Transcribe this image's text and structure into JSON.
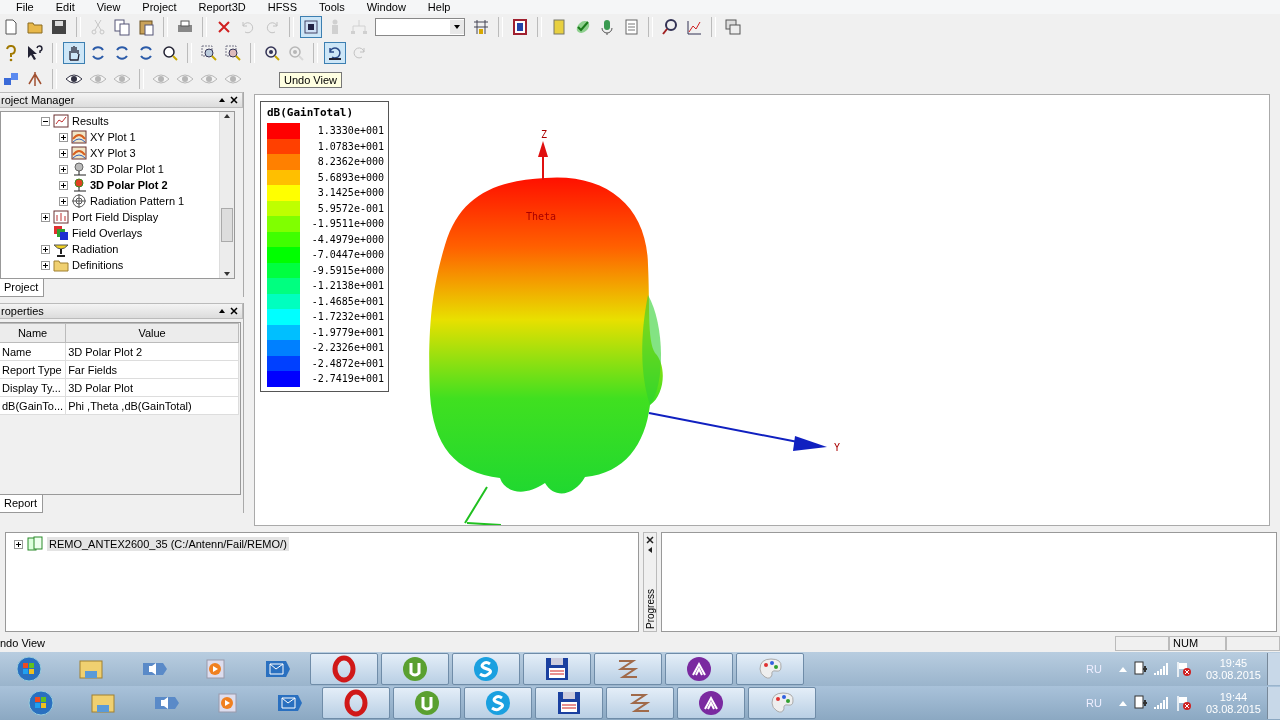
{
  "menu": [
    "File",
    "Edit",
    "View",
    "Project",
    "Report3D",
    "HFSS",
    "Tools",
    "Window",
    "Help"
  ],
  "toolbars": [
    {
      "buttons": [
        {
          "kind": "new",
          "pressed": false,
          "disabled": false
        },
        {
          "kind": "open",
          "pressed": false,
          "disabled": false
        },
        {
          "kind": "save",
          "pressed": false,
          "disabled": false
        },
        {
          "kind": "sep"
        },
        {
          "kind": "cut",
          "pressed": false,
          "disabled": true
        },
        {
          "kind": "copy",
          "pressed": false,
          "disabled": false
        },
        {
          "kind": "paste",
          "pressed": false,
          "disabled": false
        },
        {
          "kind": "sep"
        },
        {
          "kind": "print",
          "pressed": false,
          "disabled": false
        },
        {
          "kind": "sep"
        },
        {
          "kind": "delete",
          "pressed": false,
          "disabled": false
        },
        {
          "kind": "undo",
          "pressed": false,
          "disabled": true
        },
        {
          "kind": "redo",
          "pressed": false,
          "disabled": true
        },
        {
          "kind": "sep"
        },
        {
          "kind": "select",
          "pressed": true,
          "disabled": false
        },
        {
          "kind": "figure",
          "pressed": false,
          "disabled": true
        },
        {
          "kind": "network",
          "pressed": false,
          "disabled": true
        },
        {
          "kind": "combo"
        },
        {
          "kind": "grid",
          "pressed": false,
          "disabled": false
        },
        {
          "kind": "sep"
        },
        {
          "kind": "mark",
          "pressed": false,
          "disabled": false
        },
        {
          "kind": "sep"
        },
        {
          "kind": "validate",
          "pressed": false,
          "disabled": false
        },
        {
          "kind": "check",
          "pressed": false,
          "disabled": false
        },
        {
          "kind": "analyze",
          "pressed": false,
          "disabled": false
        },
        {
          "kind": "report",
          "pressed": false,
          "disabled": false
        },
        {
          "kind": "sep"
        },
        {
          "kind": "find",
          "pressed": false,
          "disabled": false
        },
        {
          "kind": "plot",
          "pressed": false,
          "disabled": false
        },
        {
          "kind": "sep"
        },
        {
          "kind": "window",
          "pressed": false,
          "disabled": false
        }
      ]
    },
    {
      "buttons": [
        {
          "kind": "help",
          "pressed": false,
          "disabled": false
        },
        {
          "kind": "whatsthis",
          "pressed": false,
          "disabled": false
        },
        {
          "kind": "sep"
        },
        {
          "kind": "pan",
          "pressed": true,
          "disabled": false
        },
        {
          "kind": "rotate",
          "pressed": false,
          "disabled": false
        },
        {
          "kind": "rotate",
          "pressed": false,
          "disabled": false
        },
        {
          "kind": "rotate",
          "pressed": false,
          "disabled": false
        },
        {
          "kind": "zoom",
          "pressed": false,
          "disabled": false
        },
        {
          "kind": "sep"
        },
        {
          "kind": "zoomin",
          "pressed": false,
          "disabled": false
        },
        {
          "kind": "zoomout",
          "pressed": false,
          "disabled": false
        },
        {
          "kind": "sep"
        },
        {
          "kind": "fit",
          "pressed": false,
          "disabled": false
        },
        {
          "kind": "fit",
          "pressed": false,
          "disabled": true
        },
        {
          "kind": "sep"
        },
        {
          "kind": "undoview",
          "pressed": true,
          "disabled": false
        },
        {
          "kind": "redoview",
          "pressed": false,
          "disabled": true
        }
      ]
    },
    {
      "buttons": [
        {
          "kind": "shape",
          "pressed": false,
          "disabled": false
        },
        {
          "kind": "antenna",
          "pressed": false,
          "disabled": false
        },
        {
          "kind": "sep"
        },
        {
          "kind": "eye",
          "pressed": false,
          "disabled": false
        },
        {
          "kind": "eye",
          "pressed": false,
          "disabled": true
        },
        {
          "kind": "eye",
          "pressed": false,
          "disabled": true
        },
        {
          "kind": "sep"
        },
        {
          "kind": "eye",
          "pressed": false,
          "disabled": true
        },
        {
          "kind": "eye",
          "pressed": false,
          "disabled": true
        },
        {
          "kind": "eye",
          "pressed": false,
          "disabled": true
        },
        {
          "kind": "eye",
          "pressed": false,
          "disabled": true
        }
      ]
    }
  ],
  "tooltip": "Undo View",
  "project_manager": {
    "title": "roject Manager",
    "tab": {
      "label": "Project",
      "selected": true
    },
    "tree": [
      {
        "label": "Results",
        "kind": "results",
        "expanded": true,
        "selected": false,
        "children": [
          {
            "label": "XY Plot 1",
            "kind": "xy-plot",
            "expanded": false,
            "selected": false
          },
          {
            "label": "XY Plot 3",
            "kind": "xy-plot",
            "expanded": false,
            "selected": false
          },
          {
            "label": "3D Polar Plot 1",
            "kind": "polar-plot",
            "expanded": false,
            "selected": false
          },
          {
            "label": "3D Polar Plot 2",
            "kind": "polar-plot-active",
            "expanded": false,
            "selected": true
          },
          {
            "label": "Radiation Pattern 1",
            "kind": "pattern",
            "expanded": false,
            "selected": false
          }
        ]
      },
      {
        "label": "Port Field Display",
        "kind": "port-field",
        "expanded": false,
        "selected": false
      },
      {
        "label": "Field Overlays",
        "kind": "overlays",
        "selected": false
      },
      {
        "label": "Radiation",
        "kind": "radiation",
        "expanded": false,
        "selected": false
      },
      {
        "label": "Definitions",
        "kind": "folder",
        "expanded": false,
        "selected": false
      }
    ]
  },
  "properties": {
    "title": "roperties",
    "tab": {
      "label": "Report",
      "selected": true
    },
    "columns": [
      "Name",
      "Value"
    ],
    "rows": [
      [
        "Name",
        "3D Polar Plot 2"
      ],
      [
        "Report Type",
        "Far Fields"
      ],
      [
        "Display Ty...",
        "3D Polar Plot"
      ],
      [
        "dB(GainTo...",
        "Phi ,Theta ,dB(GainTotal)"
      ]
    ]
  },
  "view": {
    "legend": {
      "title": "dB(GainTotal)",
      "entries": [
        {
          "value": "1.3330e+001",
          "color": "#ff0000"
        },
        {
          "value": "1.0783e+001",
          "color": "#ff4000"
        },
        {
          "value": "8.2362e+000",
          "color": "#ff8000"
        },
        {
          "value": "5.6893e+000",
          "color": "#ffbf00"
        },
        {
          "value": "3.1425e+000",
          "color": "#ffff00"
        },
        {
          "value": "5.9572e-001",
          "color": "#bfff00"
        },
        {
          "value": "-1.9511e+000",
          "color": "#80ff00"
        },
        {
          "value": "-4.4979e+000",
          "color": "#40ff00"
        },
        {
          "value": "-7.0447e+000",
          "color": "#00ff00"
        },
        {
          "value": "-9.5915e+000",
          "color": "#00ff40"
        },
        {
          "value": "-1.2138e+001",
          "color": "#00ff80"
        },
        {
          "value": "-1.4685e+001",
          "color": "#00ffbf"
        },
        {
          "value": "-1.7232e+001",
          "color": "#00ffff"
        },
        {
          "value": "-1.9779e+001",
          "color": "#00bfff"
        },
        {
          "value": "-2.2326e+001",
          "color": "#0080ff"
        },
        {
          "value": "-2.4872e+001",
          "color": "#0040ff"
        },
        {
          "value": "-2.7419e+001",
          "color": "#0000ff"
        }
      ]
    },
    "axis_labels": {
      "z": "Z",
      "y": "Y",
      "theta": "Theta"
    }
  },
  "message_tree": [
    {
      "label": "REMO_ANTEX2600_35 (C:/Antenn/Fail/REMO/)",
      "expanded": false,
      "selected": true
    }
  ],
  "progress": {
    "title": "Progress"
  },
  "status_bar": {
    "message": "ndo View",
    "indicator": "NUM"
  },
  "taskbars": [
    {
      "apps": [
        {
          "kind": "start",
          "running": false
        },
        {
          "kind": "explorer",
          "running": false
        },
        {
          "kind": "speaker",
          "running": false
        },
        {
          "kind": "media",
          "running": false
        },
        {
          "kind": "mail",
          "running": false
        },
        {
          "kind": "opera",
          "running": true
        },
        {
          "kind": "torrent",
          "running": true
        },
        {
          "kind": "skype",
          "running": true
        },
        {
          "kind": "floppy",
          "running": true
        },
        {
          "kind": "wave",
          "running": true
        },
        {
          "kind": "triangle",
          "running": true
        },
        {
          "kind": "paint",
          "running": true
        }
      ],
      "tray": {
        "language": "RU",
        "time": "19:45",
        "date": "03.08.2015"
      }
    },
    {
      "apps": [
        {
          "kind": "start",
          "running": false
        },
        {
          "kind": "explorer",
          "running": false
        },
        {
          "kind": "speaker",
          "running": false
        },
        {
          "kind": "media",
          "running": false
        },
        {
          "kind": "mail",
          "running": false
        },
        {
          "kind": "opera",
          "running": true
        },
        {
          "kind": "torrent",
          "running": true
        },
        {
          "kind": "skype",
          "running": true
        },
        {
          "kind": "floppy",
          "running": true
        },
        {
          "kind": "wave",
          "running": true
        },
        {
          "kind": "triangle",
          "running": true
        },
        {
          "kind": "paint",
          "running": true
        }
      ],
      "tray": {
        "language": "RU",
        "time": "19:44",
        "date": "03.08.2015"
      }
    }
  ]
}
